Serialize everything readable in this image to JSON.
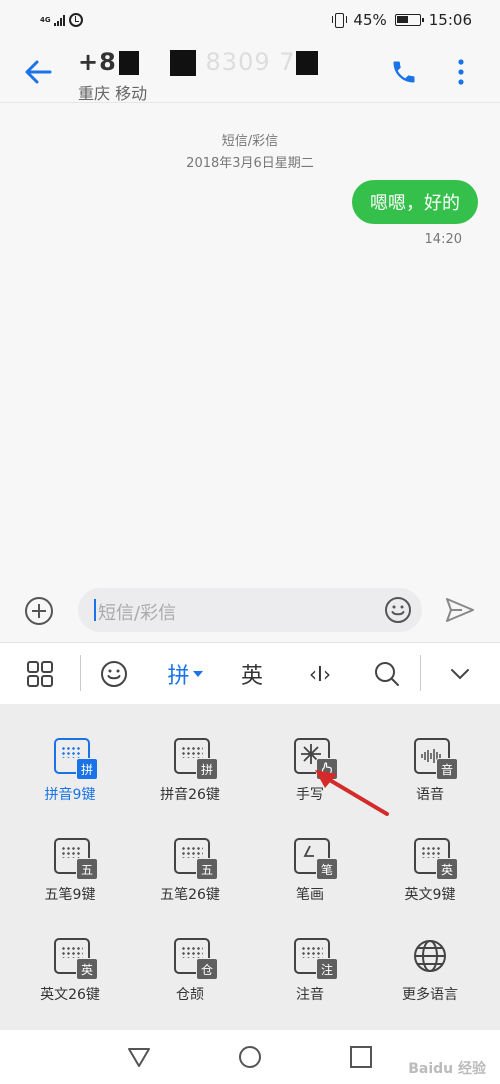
{
  "status_bar": {
    "network": "4G",
    "battery_percent": "45%",
    "time": "15:06"
  },
  "header": {
    "contact_prefix": "+8",
    "contact_visible": "8309 7",
    "contact_location": "重庆 移动"
  },
  "conversation": {
    "message_type": "短信/彩信",
    "date": "2018年3月6日星期二",
    "messages": [
      {
        "text": "嗯嗯，好的",
        "time": "14:20",
        "direction": "outgoing"
      }
    ],
    "bubble_color": "#35c04b"
  },
  "composer": {
    "placeholder": "短信/彩信"
  },
  "keyboard_toolbar": {
    "active_label": "拼",
    "english_label": "英",
    "cursor_label": "‹I›",
    "accent": "#1a73e8"
  },
  "keyboard_options": [
    {
      "label": "拼音9键",
      "badge": "拼",
      "active": true
    },
    {
      "label": "拼音26键",
      "badge": "拼",
      "active": false
    },
    {
      "label": "手写",
      "badge": "",
      "active": false
    },
    {
      "label": "语音",
      "badge": "音",
      "active": false
    },
    {
      "label": "五笔9键",
      "badge": "五",
      "active": false
    },
    {
      "label": "五笔26键",
      "badge": "五",
      "active": false
    },
    {
      "label": "笔画",
      "badge": "笔",
      "active": false
    },
    {
      "label": "英文9键",
      "badge": "英",
      "active": false
    },
    {
      "label": "英文26键",
      "badge": "英",
      "active": false
    },
    {
      "label": "仓颉",
      "badge": "仓",
      "active": false
    },
    {
      "label": "注音",
      "badge": "注",
      "active": false
    },
    {
      "label": "更多语言",
      "badge": "",
      "active": false
    }
  ],
  "watermark": "Baidu 经验"
}
